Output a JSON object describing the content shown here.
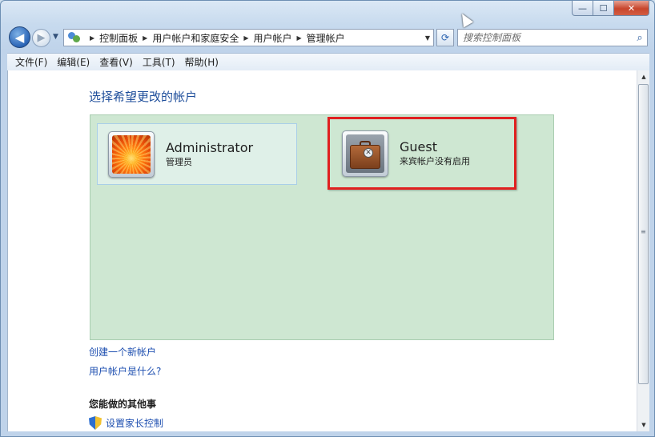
{
  "window": {
    "caption": {
      "minimize": "—",
      "maximize": "☐",
      "close": "✕"
    }
  },
  "nav": {
    "back": "◀",
    "forward": "▶",
    "recent": "▼",
    "breadcrumbs": [
      "控制面板",
      "用户帐户和家庭安全",
      "用户帐户",
      "管理帐户"
    ],
    "separator": "▶",
    "dropdown": "▼",
    "refresh": "⟳",
    "search_placeholder": "搜索控制面板",
    "search_icon": "⌕"
  },
  "menu": {
    "items": [
      "文件(F)",
      "编辑(E)",
      "查看(V)",
      "工具(T)",
      "帮助(H)"
    ]
  },
  "content": {
    "title": "选择希望更改的帐户",
    "accounts": [
      {
        "name": "Administrator",
        "role": "管理员",
        "icon": "flower-avatar"
      },
      {
        "name": "Guest",
        "role": "来宾帐户没有启用",
        "icon": "briefcase-avatar"
      }
    ],
    "links": {
      "create": "创建一个新帐户",
      "what_is": "用户帐户是什么?"
    },
    "other_tasks_heading": "您能做的其他事",
    "tasks": [
      {
        "label": "设置家长控制",
        "icon": "shield-icon"
      }
    ],
    "highlight_color": "#e02020",
    "panel_color": "#cee7d2"
  },
  "scrollbar": {
    "up": "▲",
    "down": "▼",
    "grip": "≡"
  }
}
